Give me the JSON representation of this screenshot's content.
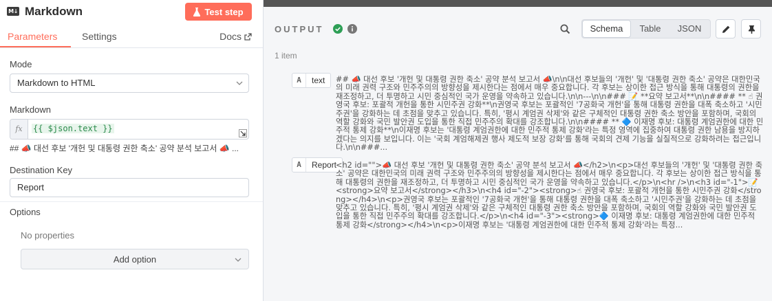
{
  "node": {
    "title": "Markdown",
    "icon": "M↓",
    "test_button": "Test step"
  },
  "tabs": {
    "parameters": "Parameters",
    "settings": "Settings",
    "docs": "Docs"
  },
  "mode": {
    "label": "Mode",
    "value": "Markdown to HTML"
  },
  "markdown": {
    "label": "Markdown",
    "fx": "fx",
    "expression": "{{ $json.text }}",
    "preview": "## 📣 대선 후보 '개헌 및 대통령 권한 축소' 공약 분석 보고서 📣 ..."
  },
  "destination_key": {
    "label": "Destination Key",
    "value": "Report"
  },
  "options": {
    "label": "Options",
    "empty": "No properties",
    "add_button": "Add option"
  },
  "output": {
    "title": "OUTPUT",
    "views": [
      "Schema",
      "Table",
      "JSON"
    ],
    "active_view": "Schema",
    "item_count": "1 item",
    "fields": [
      {
        "type": "A",
        "name": "text",
        "value": "## 📣 대선 후보 '개헌 및 대통령 권한 축소' 공약 분석 보고서 📣\\n\\n대선 후보들의 '개헌' 및 '대통령 권한 축소' 공약은 대한민국의 미래 권력 구조와 민주주의의 방향성을 제시한다는 점에서 매우 중요합니다. 각 후보는 상이한 접근 방식을 통해 대통령의 권한을 재조정하고, 더 투명하고 시민 중심적인 국가 운영을 약속하고 있습니다.\\n\\n---\\n\\n### 📝 **요약 보고서**\\n\\n#### ** ☝ 권영국 후보: 포괄적 개헌을 통한 시민주권 강화**\\n권영국 후보는 포괄적인 '7공화국 개헌'을 통해 대통령 권한을 대폭 축소하고 '시민주권'을 강화하는 데 초점을 맞추고 있습니다. 특히, '평시 계엄권 삭제'와 같은 구체적인 대통령 권한 축소 방안을 포함하며, 국회의 역할 강화와 국민 발안권 도입을 통한 직접 민주주의 확대를 강조합니다.\\n\\n#### ** 🔷 이재명 후보: 대통령 계엄권한에 대한 민주적 통제 강화**\\n이재명 후보는 '대통령 계엄권한에 대한 민주적 통제 강화'라는 특정 영역에 집중하여 대통령 권한 남용을 방지하겠다는 의지를 보입니다. 이는 '국회 계엄해제권 행사 제도적 보장 강화'를 통해 국회의 견제 기능을 실질적으로 강화하려는 접근입니다.\\n\\n###..."
      },
      {
        "type": "A",
        "name": "Report",
        "value": "<h2 id=\"\">📣 대선 후보 '개헌 및 대통령 권한 축소' 공약 분석 보고서 📣</h2>\\n<p>대선 후보들의 '개헌' 및 '대통령 권한 축소' 공약은 대한민국의 미래 권력 구조와 민주주의의 방향성을 제시한다는 점에서 매우 중요합니다. 각 후보는 상이한 접근 방식을 통해 대통령의 권한을 재조정하고, 더 투명하고 시민 중심적인 국가 운영을 약속하고 있습니다.</p>\\n<hr />\\n<h3 id=\"-1\">📝 <strong>요약 보고서</strong></h3>\\n<h4 id=\"-2\"><strong>☝ 권영국 후보: 포괄적 개헌을 통한 시민주권 강화</strong></h4>\\n<p>권영국 후보는 포괄적인 '7공화국 개헌'을 통해 대통령 권한을 대폭 축소하고 '시민주권'을 강화하는 데 초점을 맞추고 있습니다. 특히, '평시 계엄권 삭제'와 같은 구체적인 대통령 권한 축소 방안을 포함하며, 국회의 역할 강화와 국민 발안권 도입을 통한 직접 민주주의 확대를 강조합니다.</p>\\n<h4 id=\"-3\"><strong>🔷 이재명 후보: 대통령 계엄권한에 대한 민주적 통제 강화</strong></h4>\\n<p>이재명 후보는 '대통령 계엄권한에 대한 민주적 통제 강화'라는 특정..."
      }
    ]
  },
  "colors": {
    "accent": "#ff6d5a",
    "success": "#2e9f56",
    "expression_green": "#2b8a4b"
  },
  "icons": [
    "markdown-icon",
    "flask-icon",
    "external-link-icon",
    "chevron-down-icon",
    "expand-icon",
    "check-circle-icon",
    "info-icon",
    "search-icon",
    "pencil-icon",
    "pin-icon"
  ]
}
